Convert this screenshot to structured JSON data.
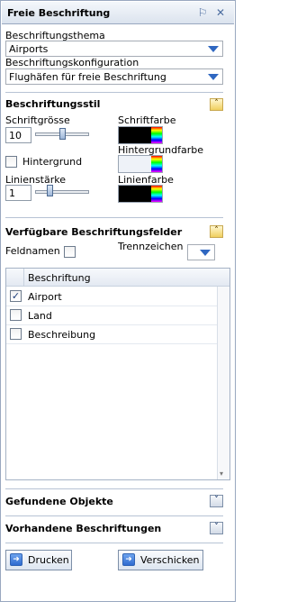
{
  "panel": {
    "title": "Freie Beschriftung",
    "pin_icon": "pin-icon",
    "close_icon": "close-icon"
  },
  "labels": {
    "theme_label": "Beschriftungsthema",
    "theme_value": "Airports",
    "config_label": "Beschriftungskonfiguration",
    "config_value": "Flughäfen für freie Beschriftung"
  },
  "style": {
    "title": "Beschriftungsstil",
    "font_size_label": "Schriftgrösse",
    "font_size_value": "10",
    "font_size_level": 0.5,
    "font_color_label": "Schriftfarbe",
    "font_color": "#000000",
    "background_color_label": "Hintergrundfarbe",
    "background_color": "#eef2f8",
    "background_label": "Hintergrund",
    "background_checked": false,
    "line_width_label": "Linienstärke",
    "line_width_value": "1",
    "line_width_level": 0.25,
    "line_color_label": "Linienfarbe",
    "line_color": "#000000"
  },
  "fields": {
    "title": "Verfügbare Beschriftungsfelder",
    "fieldnames_label": "Feldnamen",
    "fieldnames_checked": false,
    "separator_label": "Trennzeichen",
    "column_header": "Beschriftung",
    "rows": [
      {
        "label": "Airport",
        "checked": true
      },
      {
        "label": "Land",
        "checked": false
      },
      {
        "label": "Beschreibung",
        "checked": false
      }
    ]
  },
  "found": {
    "title": "Gefundene Objekte"
  },
  "existing": {
    "title": "Vorhandene Beschriftungen"
  },
  "actions": {
    "print_label": "Drucken",
    "send_label": "Verschicken"
  },
  "colors": {
    "accent": "#2f67c1",
    "border": "#99a8c0",
    "expand_active": "#f0cf5e"
  }
}
